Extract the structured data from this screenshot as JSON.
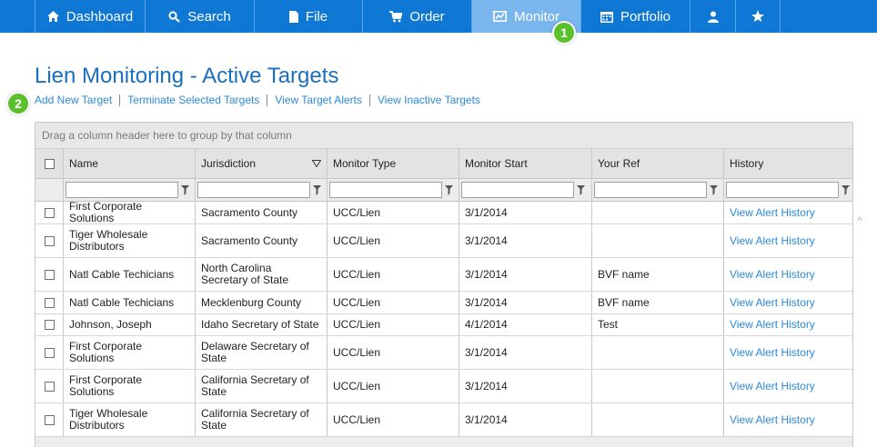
{
  "nav": {
    "items": [
      {
        "label": "Dashboard",
        "icon": "home-icon"
      },
      {
        "label": "Search",
        "icon": "search-icon"
      },
      {
        "label": "File",
        "icon": "file-icon"
      },
      {
        "label": "Order",
        "icon": "cart-icon"
      },
      {
        "label": "Monitor",
        "icon": "monitor-chart-icon",
        "active": true
      },
      {
        "label": "Portfolio",
        "icon": "calendar-icon"
      },
      {
        "label": "",
        "icon": "user-icon"
      },
      {
        "label": "",
        "icon": "star-icon"
      }
    ]
  },
  "callouts": [
    "1",
    "2"
  ],
  "page": {
    "title": "Lien Monitoring - Active Targets",
    "actions": [
      "Add New Target",
      "Terminate Selected Targets",
      "View Target Alerts",
      "View Inactive Targets"
    ]
  },
  "grid": {
    "group_hint": "Drag a column header here to group by that column",
    "columns": [
      "Name",
      "Jurisdiction",
      "Monitor Type",
      "Monitor Start",
      "Your Ref",
      "History"
    ],
    "sorted_column": "Jurisdiction",
    "rows": [
      {
        "name": "First Corporate Solutions",
        "jurisdiction": "Sacramento County",
        "type": "UCC/Lien",
        "start": "3/1/2014",
        "ref": "",
        "history": "View Alert History"
      },
      {
        "name": "Tiger Wholesale Distributors",
        "jurisdiction": "Sacramento County",
        "type": "UCC/Lien",
        "start": "3/1/2014",
        "ref": "",
        "history": "View Alert History"
      },
      {
        "name": "Natl Cable Techicians",
        "jurisdiction": "North Carolina Secretary of State",
        "type": "UCC/Lien",
        "start": "3/1/2014",
        "ref": "BVF name",
        "history": "View Alert History"
      },
      {
        "name": "Natl Cable Techicians",
        "jurisdiction": "Mecklenburg County",
        "type": "UCC/Lien",
        "start": "3/1/2014",
        "ref": "BVF name",
        "history": "View Alert History"
      },
      {
        "name": "Johnson, Joseph",
        "jurisdiction": "Idaho Secretary of State",
        "type": "UCC/Lien",
        "start": "4/1/2014",
        "ref": "Test",
        "history": "View Alert History"
      },
      {
        "name": "First Corporate Solutions",
        "jurisdiction": "Delaware Secretary of State",
        "type": "UCC/Lien",
        "start": "3/1/2014",
        "ref": "",
        "history": "View Alert History"
      },
      {
        "name": "First Corporate Solutions",
        "jurisdiction": "California Secretary of State",
        "type": "UCC/Lien",
        "start": "3/1/2014",
        "ref": "",
        "history": "View Alert History"
      },
      {
        "name": "Tiger Wholesale Distributors",
        "jurisdiction": "California Secretary of State",
        "type": "UCC/Lien",
        "start": "3/1/2014",
        "ref": "",
        "history": "View Alert History"
      }
    ]
  },
  "colors": {
    "nav_bg": "#0f77d4",
    "nav_active": "#7ab6ee",
    "link": "#2b8ad9",
    "title": "#1a6fbf",
    "badge": "#5ac12b"
  }
}
